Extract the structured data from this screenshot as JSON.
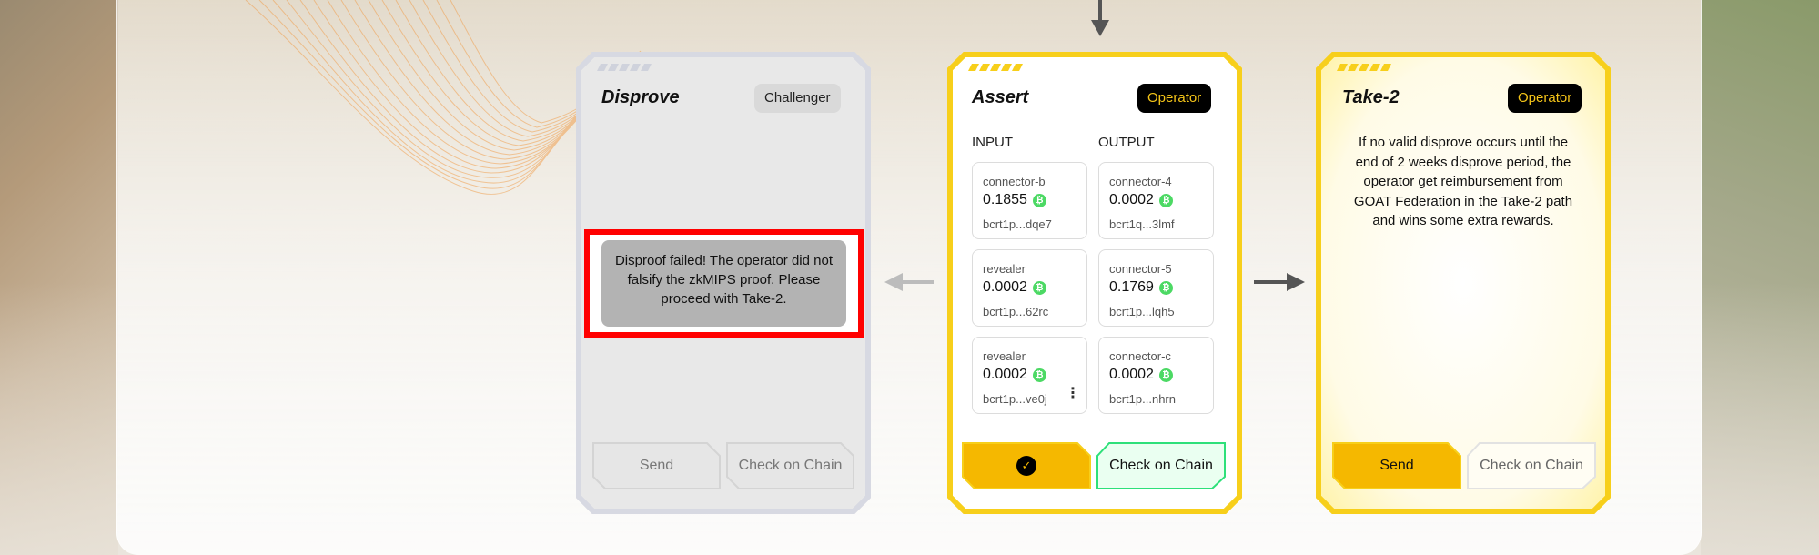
{
  "disprove": {
    "title": "Disprove",
    "role": "Challenger",
    "dialog": "Disproof failed! The operator did not falsify the zkMIPS proof. Please proceed with Take-2.",
    "send_label": "Send",
    "check_label": "Check on Chain"
  },
  "assert": {
    "title": "Assert",
    "role": "Operator",
    "input_label": "INPUT",
    "output_label": "OUTPUT",
    "inputs": [
      {
        "name": "connector-b",
        "amount": "0.1855",
        "addr": "bcrt1p...dqe7"
      },
      {
        "name": "revealer",
        "amount": "0.0002",
        "addr": "bcrt1p...62rc"
      },
      {
        "name": "revealer",
        "amount": "0.0002",
        "addr": "bcrt1p...ve0j"
      }
    ],
    "outputs": [
      {
        "name": "connector-4",
        "amount": "0.0002",
        "addr": "bcrt1q...3lmf"
      },
      {
        "name": "connector-5",
        "amount": "0.1769",
        "addr": "bcrt1p...lqh5"
      },
      {
        "name": "connector-c",
        "amount": "0.0002",
        "addr": "bcrt1p...nhrn"
      }
    ],
    "more_symbol": "⋮",
    "check_label": "Check on Chain"
  },
  "take2": {
    "title": "Take-2",
    "role": "Operator",
    "description": "If no valid disprove occurs until the end of 2 weeks disprove period, the operator get reimbursement from GOAT Federation in the Take-2 path and wins some extra rewards.",
    "send_label": "Send",
    "check_label": "Check on Chain"
  },
  "icons": {
    "btc_glyph": "₿",
    "check_glyph": "✓"
  },
  "colors": {
    "accent_yellow": "#f7cf1b",
    "button_yellow": "#f5b800",
    "disabled_gray": "#e3e3e6",
    "green_outline": "#2ee07a",
    "highlight_red": "#ff0000"
  }
}
